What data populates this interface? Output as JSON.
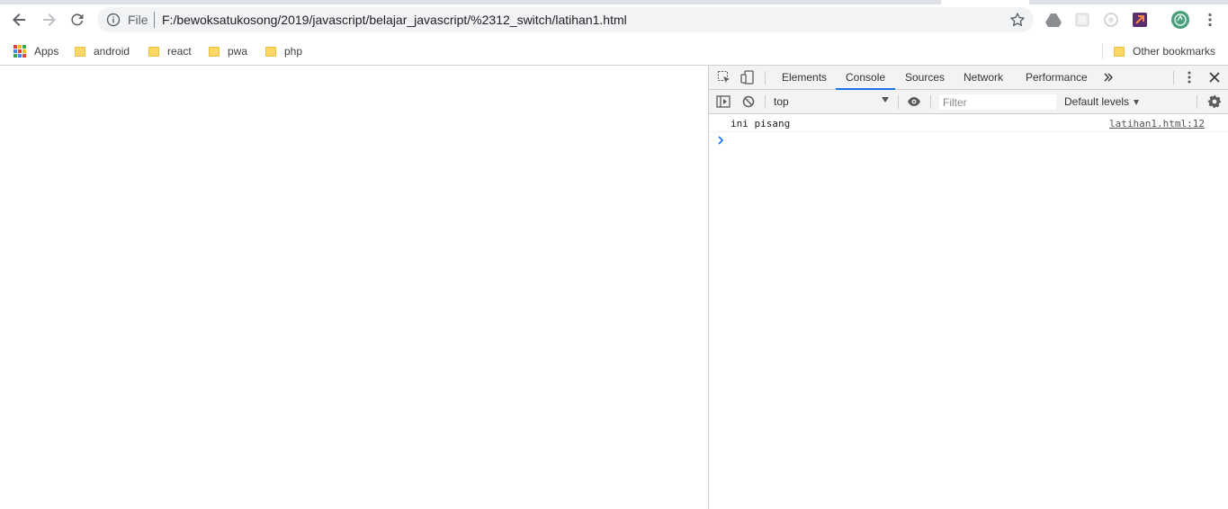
{
  "browser": {
    "omnibox": {
      "scheme_label": "File",
      "url": "F:/bewoksatukosong/2019/javascript/belajar_javascript/%2312_switch/latihan1.html"
    },
    "bookmarks": [
      {
        "label": "Apps",
        "icon": "apps-grid-icon"
      },
      {
        "label": "android",
        "icon": "folder-icon"
      },
      {
        "label": "react",
        "icon": "folder-icon"
      },
      {
        "label": "pwa",
        "icon": "folder-icon"
      },
      {
        "label": "php",
        "icon": "folder-icon"
      }
    ],
    "other_bookmarks": "Other bookmarks"
  },
  "devtools": {
    "tabs": [
      {
        "label": "Elements"
      },
      {
        "label": "Console"
      },
      {
        "label": "Sources"
      },
      {
        "label": "Network"
      },
      {
        "label": "Performance"
      }
    ],
    "active_tab": "Console",
    "console": {
      "context": "top",
      "filter_placeholder": "Filter",
      "levels": "Default levels",
      "messages": [
        {
          "text": "ini pisang",
          "source": "latihan1.html:12"
        }
      ]
    }
  },
  "colors": {
    "accent": "#1a73e8",
    "folder": "#fdd663",
    "avatar": "#4aa07a"
  }
}
